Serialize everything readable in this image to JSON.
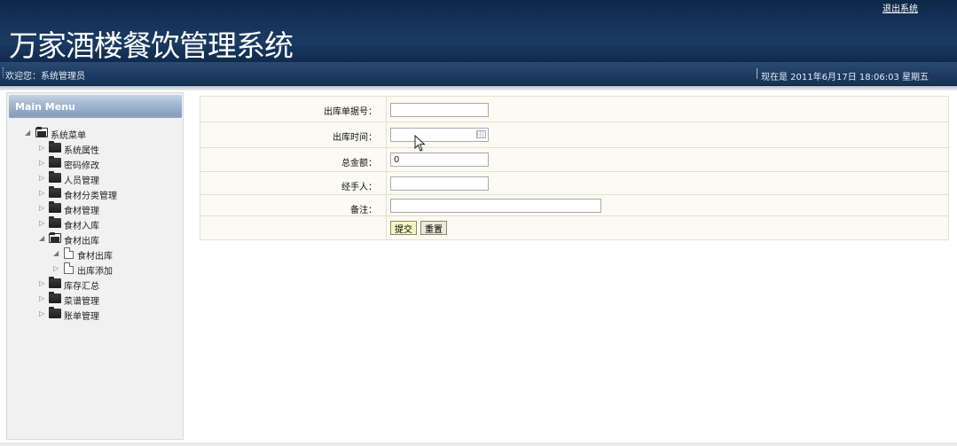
{
  "header": {
    "title": "万家酒楼餐饮管理系统",
    "logout_label": "退出系统"
  },
  "subbar": {
    "welcome": "欢迎您：系统管理员",
    "clock": "现在是 2011年6月17日 18:06:03 星期五"
  },
  "sidebar": {
    "menu_title": "Main Menu",
    "root": "系统菜单",
    "items": [
      {
        "label": "系统属性"
      },
      {
        "label": "密码修改"
      },
      {
        "label": "人员管理"
      },
      {
        "label": "食材分类管理"
      },
      {
        "label": "食材管理"
      },
      {
        "label": "食材入库"
      },
      {
        "label": "食材出库"
      },
      {
        "label": "食材出库"
      },
      {
        "label": "出库添加"
      },
      {
        "label": "库存汇总"
      },
      {
        "label": "菜谱管理"
      },
      {
        "label": "账单管理"
      }
    ]
  },
  "form": {
    "fields": [
      {
        "label": "出库单据号：",
        "value": ""
      },
      {
        "label": "出库时间：",
        "value": ""
      },
      {
        "label": "总金额：",
        "value": "0"
      },
      {
        "label": "经手人：",
        "value": ""
      },
      {
        "label": "备注：",
        "value": ""
      }
    ],
    "submit_label": "提交",
    "reset_label": "重置"
  },
  "icons": {
    "folder": "folder-icon",
    "document": "document-icon",
    "calendar": "calendar-icon",
    "cursor": "mouse-pointer-icon"
  }
}
